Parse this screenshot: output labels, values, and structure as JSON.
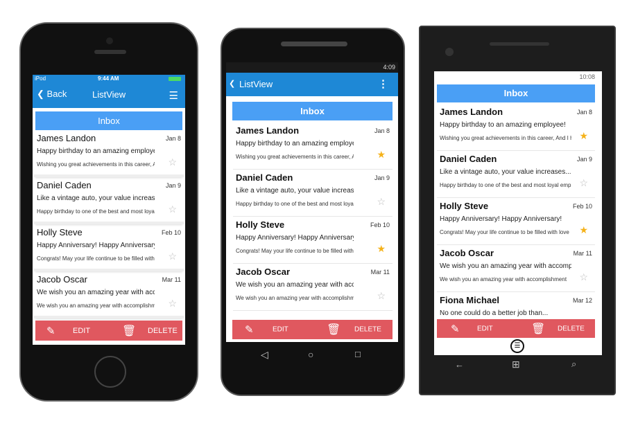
{
  "ios": {
    "status": {
      "carrier": "iPod",
      "time": "9:44 AM"
    },
    "nav": {
      "back": "Back",
      "title": "ListView",
      "menu_icon": "hamburger-icon"
    },
    "starred": [
      false,
      false,
      false,
      false
    ]
  },
  "android": {
    "status": {
      "time": "4:09"
    },
    "toolbar": {
      "title": "ListView",
      "menu_icon": "more-vert-icon"
    },
    "starred": [
      true,
      false,
      true,
      false
    ]
  },
  "windows": {
    "status": {
      "time": "10:08"
    },
    "starred": [
      true,
      false,
      true,
      false,
      false
    ]
  },
  "inbox_label": "Inbox",
  "emails": [
    {
      "name": "James Landon",
      "date": "Jan 8",
      "subject": "Happy birthday to an amazing employee!",
      "body": "Wishing you great achievements in this career, And I h"
    },
    {
      "name": "Daniel Caden",
      "date": "Jan 9",
      "subject": "Like a vintage auto, your value increases...",
      "body": "Happy birthday to one of the best and most loyal emp"
    },
    {
      "name": "Holly Steve",
      "date": "Feb 10",
      "subject": "Happy Anniversary! Happy Anniversary!",
      "body": "Congrats! May your life continue to be filled with love"
    },
    {
      "name": "Jacob Oscar",
      "date": "Mar 11",
      "subject": "We wish you an amazing year with accomplis",
      "body": "We wish you an amazing year with accomplishment"
    },
    {
      "name": "Fiona Michael",
      "date": "Mar 12",
      "subject": "No one could do a better job than...",
      "body": ""
    }
  ],
  "actions": {
    "edit": "EDIT",
    "delete": "DELETE"
  },
  "colors": {
    "nav_blue": "#1e88d6",
    "inbox_blue": "#4a9ff5",
    "action_red": "#e0585f",
    "star_gold": "#f5b21a"
  }
}
